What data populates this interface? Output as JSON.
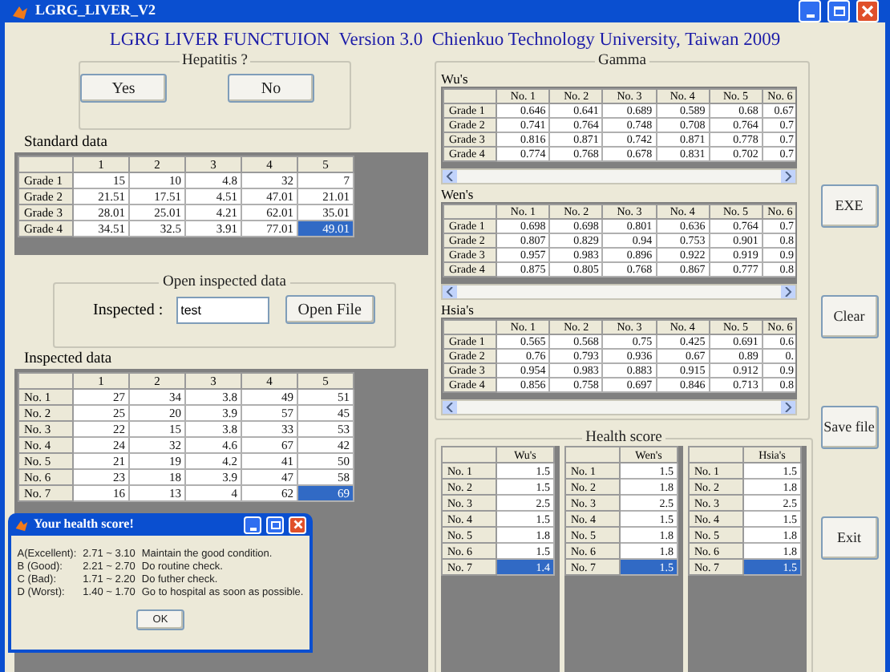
{
  "window": {
    "title": "LGRG_LIVER_V2"
  },
  "heading": "LGRG LIVER FUNCTUION  Version 3.0  Chienkuo Technology University, Taiwan 2009",
  "hepatitis": {
    "title": "Hepatitis ?",
    "buttons": [
      "Yes",
      "No"
    ]
  },
  "standard_data": {
    "label": "Standard data",
    "columns": [
      "1",
      "2",
      "3",
      "4",
      "5"
    ],
    "rows": [
      {
        "header": "Grade 1",
        "cells": [
          {
            "text": "15",
            "selected": false
          },
          {
            "text": "10",
            "selected": false
          },
          {
            "text": "4.8",
            "selected": false
          },
          {
            "text": "32",
            "selected": false
          },
          {
            "text": "7",
            "selected": false
          }
        ]
      },
      {
        "header": "Grade 2",
        "cells": [
          {
            "text": "21.51",
            "selected": false
          },
          {
            "text": "17.51",
            "selected": false
          },
          {
            "text": "4.51",
            "selected": false
          },
          {
            "text": "47.01",
            "selected": false
          },
          {
            "text": "21.01",
            "selected": false
          }
        ]
      },
      {
        "header": "Grade 3",
        "cells": [
          {
            "text": "28.01",
            "selected": false
          },
          {
            "text": "25.01",
            "selected": false
          },
          {
            "text": "4.21",
            "selected": false
          },
          {
            "text": "62.01",
            "selected": false
          },
          {
            "text": "35.01",
            "selected": false
          }
        ]
      },
      {
        "header": "Grade 4",
        "cells": [
          {
            "text": "34.51",
            "selected": false
          },
          {
            "text": "32.5",
            "selected": false
          },
          {
            "text": "3.91",
            "selected": false
          },
          {
            "text": "77.01",
            "selected": false
          },
          {
            "text": "49.01",
            "selected": true
          }
        ]
      }
    ]
  },
  "open_inspected": {
    "title": "Open inspected data",
    "label": "Inspected :",
    "value": "test",
    "button": "Open File"
  },
  "inspected_data": {
    "label": "Inspected data",
    "columns": [
      "1",
      "2",
      "3",
      "4",
      "5"
    ],
    "rows": [
      {
        "header": "No. 1",
        "cells": [
          {
            "text": "27",
            "selected": false
          },
          {
            "text": "34",
            "selected": false
          },
          {
            "text": "3.8",
            "selected": false
          },
          {
            "text": "49",
            "selected": false
          },
          {
            "text": "51",
            "selected": false
          }
        ]
      },
      {
        "header": "No. 2",
        "cells": [
          {
            "text": "25",
            "selected": false
          },
          {
            "text": "20",
            "selected": false
          },
          {
            "text": "3.9",
            "selected": false
          },
          {
            "text": "57",
            "selected": false
          },
          {
            "text": "45",
            "selected": false
          }
        ]
      },
      {
        "header": "No. 3",
        "cells": [
          {
            "text": "22",
            "selected": false
          },
          {
            "text": "15",
            "selected": false
          },
          {
            "text": "3.8",
            "selected": false
          },
          {
            "text": "33",
            "selected": false
          },
          {
            "text": "53",
            "selected": false
          }
        ]
      },
      {
        "header": "No. 4",
        "cells": [
          {
            "text": "24",
            "selected": false
          },
          {
            "text": "32",
            "selected": false
          },
          {
            "text": "4.6",
            "selected": false
          },
          {
            "text": "67",
            "selected": false
          },
          {
            "text": "42",
            "selected": false
          }
        ]
      },
      {
        "header": "No. 5",
        "cells": [
          {
            "text": "21",
            "selected": false
          },
          {
            "text": "19",
            "selected": false
          },
          {
            "text": "4.2",
            "selected": false
          },
          {
            "text": "41",
            "selected": false
          },
          {
            "text": "50",
            "selected": false
          }
        ]
      },
      {
        "header": "No. 6",
        "cells": [
          {
            "text": "23",
            "selected": false
          },
          {
            "text": "18",
            "selected": false
          },
          {
            "text": "3.9",
            "selected": false
          },
          {
            "text": "47",
            "selected": false
          },
          {
            "text": "58",
            "selected": false
          }
        ]
      },
      {
        "header": "No. 7",
        "cells": [
          {
            "text": "16",
            "selected": false
          },
          {
            "text": "13",
            "selected": false
          },
          {
            "text": "4",
            "selected": false
          },
          {
            "text": "62",
            "selected": false
          },
          {
            "text": "69",
            "selected": true
          }
        ]
      }
    ]
  },
  "dialog": {
    "title": "Your health score!",
    "rows": [
      {
        "grade": "A(Excellent):",
        "range": "2.71 ~ 3.10",
        "advice": "Maintain the good condition."
      },
      {
        "grade": "B (Good):",
        "range": "2.21 ~ 2.70",
        "advice": "Do routine check."
      },
      {
        "grade": "C (Bad):",
        "range": "1.71 ~ 2.20",
        "advice": "Do futher check."
      },
      {
        "grade": "D (Worst):",
        "range": "1.40 ~ 1.70",
        "advice": "Go to hospital as soon as possible."
      }
    ],
    "button": "OK"
  },
  "gamma": {
    "title": "Gamma",
    "tables": [
      {
        "label": "Wu's",
        "columns": [
          "No. 1",
          "No. 2",
          "No. 3",
          "No. 4",
          "No. 5",
          "No. 6"
        ],
        "rows": [
          {
            "header": "Grade 1",
            "cells": [
              "0.646",
              "0.641",
              "0.689",
              "0.589",
              "0.68",
              "0.67"
            ]
          },
          {
            "header": "Grade 2",
            "cells": [
              "0.741",
              "0.764",
              "0.748",
              "0.708",
              "0.764",
              "0.7"
            ]
          },
          {
            "header": "Grade 3",
            "cells": [
              "0.816",
              "0.871",
              "0.742",
              "0.871",
              "0.778",
              "0.7"
            ]
          },
          {
            "header": "Grade 4",
            "cells": [
              "0.774",
              "0.768",
              "0.678",
              "0.831",
              "0.702",
              "0.7"
            ]
          }
        ]
      },
      {
        "label": "Wen's",
        "columns": [
          "No. 1",
          "No. 2",
          "No. 3",
          "No. 4",
          "No. 5",
          "No. 6"
        ],
        "rows": [
          {
            "header": "Grade 1",
            "cells": [
              "0.698",
              "0.698",
              "0.801",
              "0.636",
              "0.764",
              "0.7"
            ]
          },
          {
            "header": "Grade 2",
            "cells": [
              "0.807",
              "0.829",
              "0.94",
              "0.753",
              "0.901",
              "0.8"
            ]
          },
          {
            "header": "Grade 3",
            "cells": [
              "0.957",
              "0.983",
              "0.896",
              "0.922",
              "0.919",
              "0.9"
            ]
          },
          {
            "header": "Grade 4",
            "cells": [
              "0.875",
              "0.805",
              "0.768",
              "0.867",
              "0.777",
              "0.8"
            ]
          }
        ]
      },
      {
        "label": "Hsia's",
        "columns": [
          "No. 1",
          "No. 2",
          "No. 3",
          "No. 4",
          "No. 5",
          "No. 6"
        ],
        "rows": [
          {
            "header": "Grade 1",
            "cells": [
              "0.565",
              "0.568",
              "0.75",
              "0.425",
              "0.691",
              "0.6"
            ]
          },
          {
            "header": "Grade 2",
            "cells": [
              "0.76",
              "0.793",
              "0.936",
              "0.67",
              "0.89",
              "0."
            ]
          },
          {
            "header": "Grade 3",
            "cells": [
              "0.954",
              "0.983",
              "0.883",
              "0.915",
              "0.912",
              "0.9"
            ]
          },
          {
            "header": "Grade 4",
            "cells": [
              "0.856",
              "0.758",
              "0.697",
              "0.846",
              "0.713",
              "0.8"
            ]
          }
        ]
      }
    ]
  },
  "health_score": {
    "title": "Health score",
    "tables": [
      {
        "column": "Wu's",
        "rows": [
          {
            "header": "No. 1",
            "value": "1.5",
            "selected": false
          },
          {
            "header": "No. 2",
            "value": "1.5",
            "selected": false
          },
          {
            "header": "No. 3",
            "value": "2.5",
            "selected": false
          },
          {
            "header": "No. 4",
            "value": "1.5",
            "selected": false
          },
          {
            "header": "No. 5",
            "value": "1.8",
            "selected": false
          },
          {
            "header": "No. 6",
            "value": "1.5",
            "selected": false
          },
          {
            "header": "No. 7",
            "value": "1.4",
            "selected": true
          }
        ]
      },
      {
        "column": "Wen's",
        "rows": [
          {
            "header": "No. 1",
            "value": "1.5",
            "selected": false
          },
          {
            "header": "No. 2",
            "value": "1.8",
            "selected": false
          },
          {
            "header": "No. 3",
            "value": "2.5",
            "selected": false
          },
          {
            "header": "No. 4",
            "value": "1.5",
            "selected": false
          },
          {
            "header": "No. 5",
            "value": "1.8",
            "selected": false
          },
          {
            "header": "No. 6",
            "value": "1.8",
            "selected": false
          },
          {
            "header": "No. 7",
            "value": "1.5",
            "selected": true
          }
        ]
      },
      {
        "column": "Hsia's",
        "rows": [
          {
            "header": "No. 1",
            "value": "1.5",
            "selected": false
          },
          {
            "header": "No. 2",
            "value": "1.8",
            "selected": false
          },
          {
            "header": "No. 3",
            "value": "2.5",
            "selected": false
          },
          {
            "header": "No. 4",
            "value": "1.5",
            "selected": false
          },
          {
            "header": "No. 5",
            "value": "1.8",
            "selected": false
          },
          {
            "header": "No. 6",
            "value": "1.8",
            "selected": false
          },
          {
            "header": "No. 7",
            "value": "1.5",
            "selected": true
          }
        ]
      }
    ]
  },
  "actions": [
    "EXE",
    "Clear",
    "Save file",
    "Exit"
  ]
}
